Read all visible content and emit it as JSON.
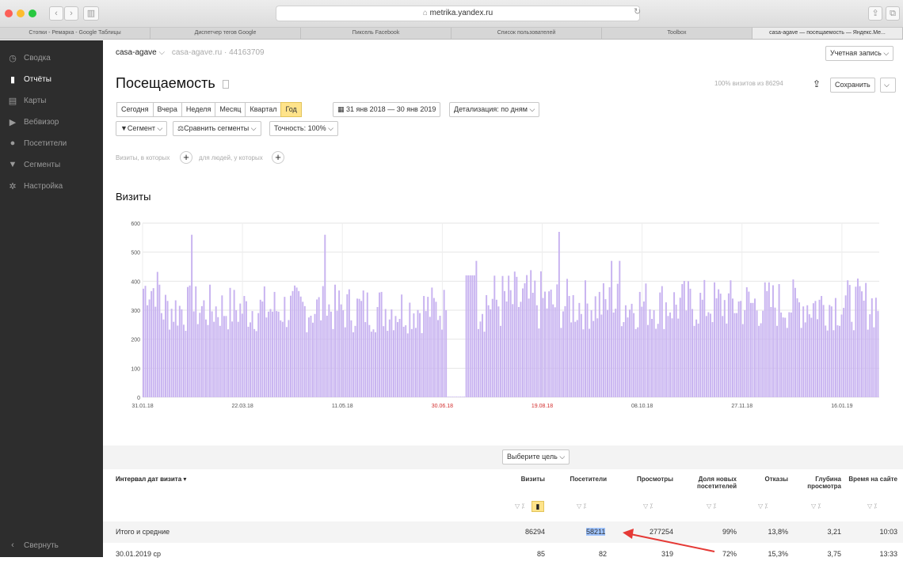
{
  "browser": {
    "url": "metrika.yandex.ru",
    "tabs": [
      "Стопки - Ремарка - Google Таблицы",
      "Диспетчер тегов Google",
      "Пиксель Facebook",
      "Список пользователей",
      "Toolbox",
      "casa-agave — посещаемость — Яндекс.Ме..."
    ]
  },
  "sidebar": {
    "items": [
      {
        "label": "Сводка",
        "icon": "dashboard-icon"
      },
      {
        "label": "Отчёты",
        "icon": "bar-chart-icon"
      },
      {
        "label": "Карты",
        "icon": "map-icon"
      },
      {
        "label": "Вебвизор",
        "icon": "play-icon"
      },
      {
        "label": "Посетители",
        "icon": "person-icon"
      },
      {
        "label": "Сегменты",
        "icon": "filter-icon"
      },
      {
        "label": "Настройка",
        "icon": "gear-icon"
      }
    ],
    "collapse": "Свернуть"
  },
  "header": {
    "counter": "casa-agave",
    "counter_detail": "casa-agave.ru · 44163709",
    "account": "Учетная запись",
    "title": "Посещаемость",
    "sample": "100% визитов из 86294",
    "save": "Сохранить"
  },
  "periods": [
    "Сегодня",
    "Вчера",
    "Неделя",
    "Месяц",
    "Квартал",
    "Год"
  ],
  "active_period": "Год",
  "date_range": "31 янв 2018 — 30 янв 2019",
  "detail": "Детализация: по дням",
  "segment": "Сегмент",
  "compare": "Сравнить сегменты",
  "accuracy": "Точность: 100%",
  "filter_hint_a": "Визиты, в которых",
  "filter_hint_b": "для людей, у которых",
  "chart_title": "Визиты",
  "goal_select": "Выберите цель",
  "table": {
    "group_header": "Интервал дат визита",
    "columns": [
      "Визиты",
      "Посетители",
      "Просмотры",
      "Доля новых посетителей",
      "Отказы",
      "Глубина просмотра",
      "Время на сайте"
    ],
    "total": {
      "label": "Итого и средние",
      "values": [
        "86294",
        "58211",
        "277254",
        "99%",
        "13,8%",
        "3,21",
        "10:03"
      ]
    },
    "rows": [
      {
        "label": "30.01.2019 ср",
        "values": [
          "85",
          "82",
          "319",
          "72%",
          "15,3%",
          "3,75",
          "13:33"
        ]
      }
    ]
  },
  "chart_data": {
    "type": "bar",
    "xlabel": "",
    "ylabel": "",
    "ylim": [
      0,
      600
    ],
    "yticks": [
      0,
      100,
      200,
      300,
      400,
      500,
      600
    ],
    "xticks": [
      "31.01.18",
      "22.03.18",
      "11.05.18",
      "30.06.18",
      "19.08.18",
      "08.10.18",
      "27.11.18",
      "16.01.19"
    ],
    "red_xticks": [
      "30.06.18",
      "19.08.18"
    ],
    "note": "Daily visits, 365 days; values approximated from picture",
    "values": []
  },
  "colors": {
    "bar": "#c8b3f0",
    "highlight": "#ffe38a",
    "sidebar": "#2d2d2d",
    "arrow": "#e53935",
    "red_tick": "#d32f2f"
  }
}
